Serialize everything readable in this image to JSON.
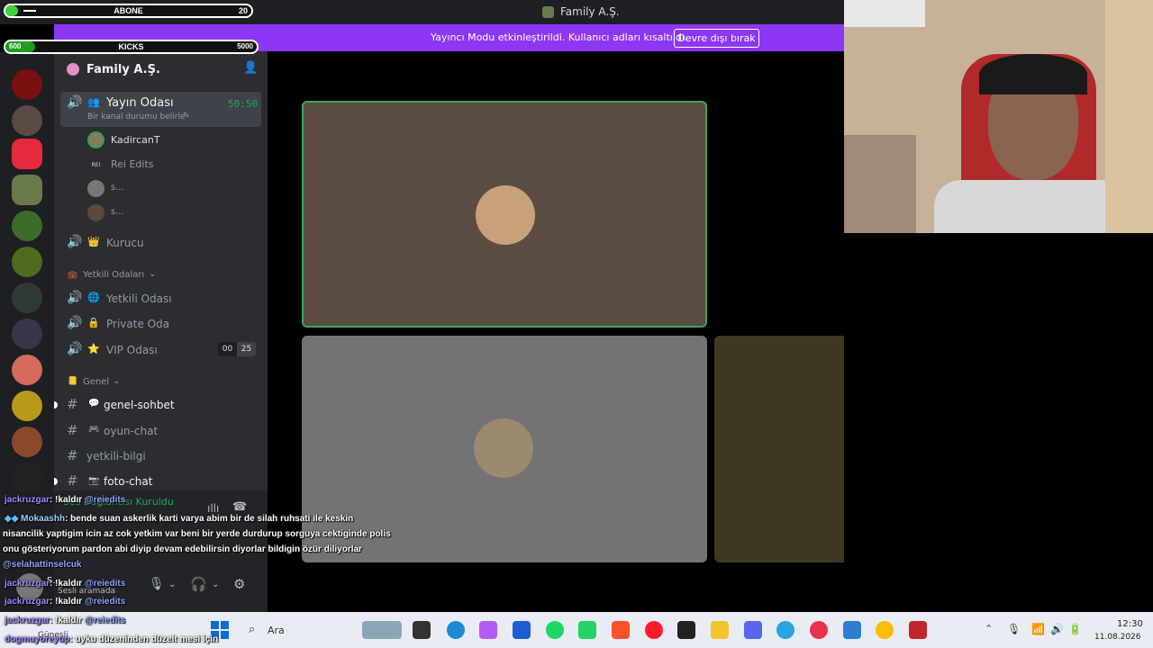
{
  "overlay": {
    "sub_goal": {
      "label": "ABONE",
      "max": "20",
      "progress": 0.05
    },
    "kick_goal": {
      "label": "KICKS",
      "current": "600",
      "max": "5000",
      "progress": 0.12
    }
  },
  "window": {
    "title": "Family A.Ş."
  },
  "banner": {
    "text": "Yayıncı Modu etkinleştirildi. Kullanıcı adları kısaltıldı.",
    "button": "Devre dışı bırak"
  },
  "server": {
    "name": "Family A.Ş."
  },
  "voice_channel": {
    "name": "Yayın Odası",
    "timer": "50:50",
    "status": "Bir kanal durumu belirle",
    "members": [
      "KadircanT",
      "Rei Edits",
      "s...",
      "s..."
    ]
  },
  "channels": {
    "kurucu": "Kurucu",
    "cat_yetkili": "Yetkili Odaları",
    "yetkili_odasi": "Yetkili Odası",
    "private_oda": "Private Oda",
    "vip_oda": "VIP Odası",
    "vip_count_a": "00",
    "vip_count_b": "25",
    "cat_genel": "Genel",
    "genel_sohbet": "genel-sohbet",
    "oyun_chat": "oyun-chat",
    "yetkili_bilgi": "yetkili-bilgi",
    "foto_chat": "foto-chat",
    "connected": "Ses Bağlantısı Kuruldu"
  },
  "user_panel": {
    "name": "S...",
    "status": "Sesli aramada"
  },
  "chat": [
    {
      "user": "jackruzgar",
      "text": ": !kaldır ",
      "mention": "@reiedits"
    },
    {
      "user": "Mokaashh",
      "text": ": bende suan askerlik karti varya abim bir de silah ruhsati ile keskin",
      "mention": ""
    },
    {
      "user": "",
      "text": "nisancilik yaptigim icin az cok yetkim var beni bir yerde durdurup sorguya cektiginde polis",
      "mention": ""
    },
    {
      "user": "",
      "text": "onu gösteriyorum pardon abi diyip devam edebilirsin diyorlar bildigin özür diliyorlar",
      "mention": ""
    },
    {
      "user": "",
      "text": "",
      "mention": "@selahattinselcuk"
    },
    {
      "user": "jackruzgar",
      "text": ": !kaldır ",
      "mention": "@reiedits"
    },
    {
      "user": "jackruzgar",
      "text": ": !kaldır ",
      "mention": "@reiedits"
    },
    {
      "user": "jackruzgar",
      "text": ": !kaldır ",
      "mention": "@reiedits"
    },
    {
      "user": "dogmuyoreyup",
      "text": ": uyku düzeninden düzelt mesi için",
      "mention": ""
    }
  ],
  "taskbar": {
    "search": "Ara",
    "time": "12:30",
    "date": "11.08.2026",
    "weather": "Güneşli"
  },
  "colors": {
    "accent": "#8d36f4",
    "voice_green": "#23a55a",
    "speaking_border": "#3ba55c"
  }
}
